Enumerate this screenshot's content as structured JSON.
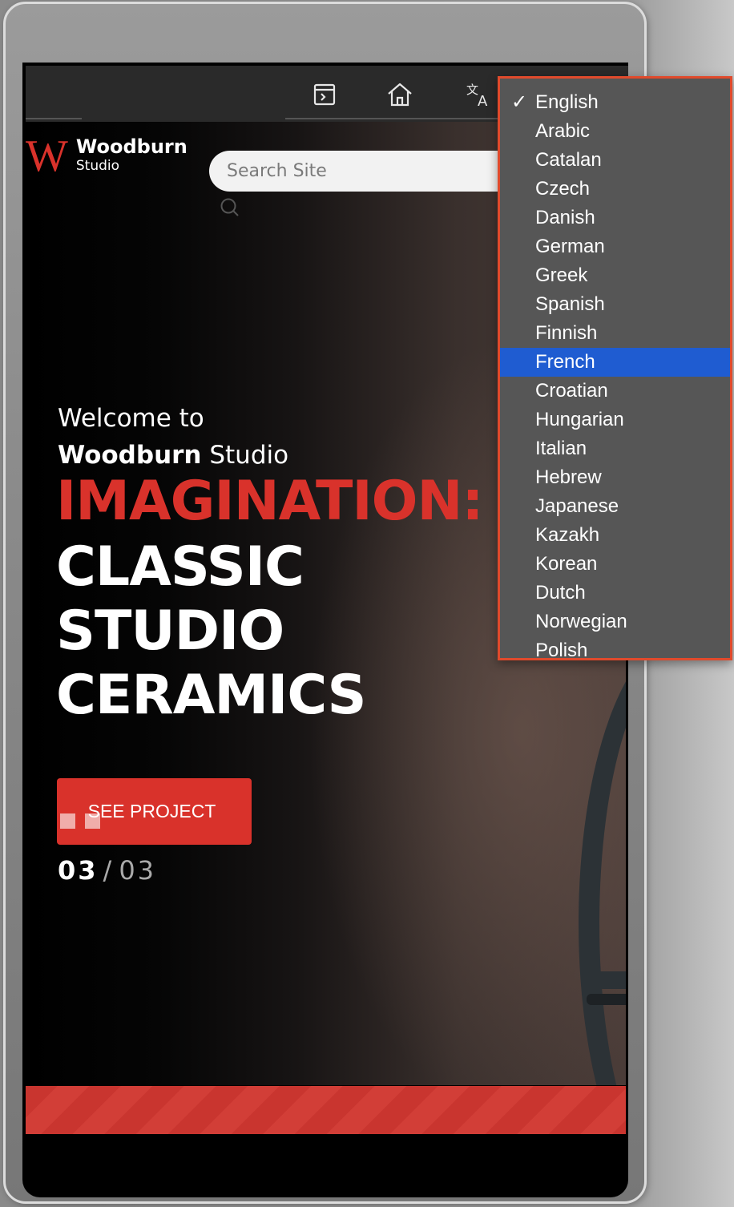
{
  "toolbar": {
    "icons": [
      "sidebar-toggle-icon",
      "home-icon",
      "translate-icon"
    ]
  },
  "logo": {
    "mark": "W",
    "name": "Woodburn",
    "sub": "Studio"
  },
  "search": {
    "placeholder": "Search Site"
  },
  "hero": {
    "welcome_line1": "Welcome to",
    "welcome_brand": "Woodburn",
    "welcome_studio": " Studio",
    "headline_red": "IMAGINATION:",
    "headline_white": [
      "CLASSIC",
      "STUDIO",
      "CERAMICS"
    ],
    "cta_label": "SEE PROJECT",
    "counter_current": "03",
    "counter_sep": "/",
    "counter_total": "03"
  },
  "language_menu": {
    "selected": "English",
    "highlighted": "French",
    "options": [
      "English",
      "Arabic",
      "Catalan",
      "Czech",
      "Danish",
      "German",
      "Greek",
      "Spanish",
      "Finnish",
      "French",
      "Croatian",
      "Hungarian",
      "Italian",
      "Hebrew",
      "Japanese",
      "Kazakh",
      "Korean",
      "Dutch",
      "Norwegian",
      "Polish"
    ],
    "check_mark": "✓"
  },
  "colors": {
    "accent": "#d9322b",
    "menu_bg": "#565656",
    "menu_highlight": "#1f5cd1",
    "menu_border": "#e04a2c"
  }
}
